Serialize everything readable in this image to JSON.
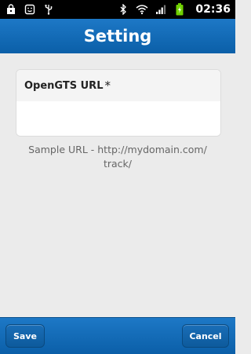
{
  "status_bar": {
    "time": "02:36",
    "left_icons": [
      "shopping-bag-icon",
      "smiley-icon",
      "usb-icon"
    ],
    "right_icons": [
      "bluetooth-icon",
      "wifi-icon",
      "signal-icon",
      "battery-charging-icon"
    ]
  },
  "header": {
    "title": "Setting"
  },
  "form": {
    "url_label": "OpenGTS URL",
    "required_mark": "*",
    "url_value": "",
    "hint": "Sample URL - http://mydomain.com/ track/"
  },
  "footer": {
    "save_label": "Save",
    "cancel_label": "Cancel"
  },
  "colors": {
    "header_blue": "#1d78c6",
    "background": "#ebebeb",
    "battery_green": "#6fd000"
  }
}
